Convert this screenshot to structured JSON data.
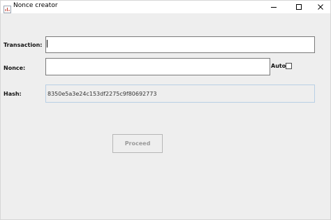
{
  "window": {
    "title": "Nonce creator"
  },
  "form": {
    "transaction_label": "Transaction:",
    "transaction_value": "",
    "nonce_label": "Nonce:",
    "nonce_value": "",
    "auto_label": "Auto:",
    "auto_checked": false,
    "hash_label": "Hash:",
    "hash_value": "8350e5a3e24c153df2275c9f80692773",
    "proceed_label": "Proceed"
  }
}
